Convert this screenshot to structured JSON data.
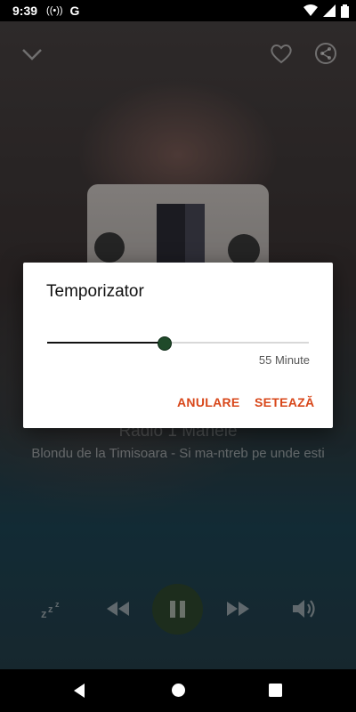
{
  "status_bar": {
    "time": "9:39",
    "g_label": "G"
  },
  "player": {
    "station_name": "Radio 1 Manele",
    "song": "Blondu de la Timisoara - Si ma-ntreb pe unde esti",
    "is_playing": true
  },
  "dialog": {
    "title": "Temporizator",
    "slider_value_fraction": 0.45,
    "minutes_label": "55 Minute",
    "cancel_label": "ANULARE",
    "set_label": "SETEAZĂ"
  },
  "colors": {
    "accent": "#d8471a",
    "slider_thumb": "#1f4a2a",
    "play_button": "#2f4a2f"
  },
  "icons": {
    "collapse": "chevron-down-icon",
    "favorite": "heart-icon",
    "share": "share-icon",
    "sleep": "zzz-icon",
    "rewind": "rewind-icon",
    "pause": "pause-icon",
    "forward": "fast-forward-icon",
    "volume": "volume-icon"
  }
}
